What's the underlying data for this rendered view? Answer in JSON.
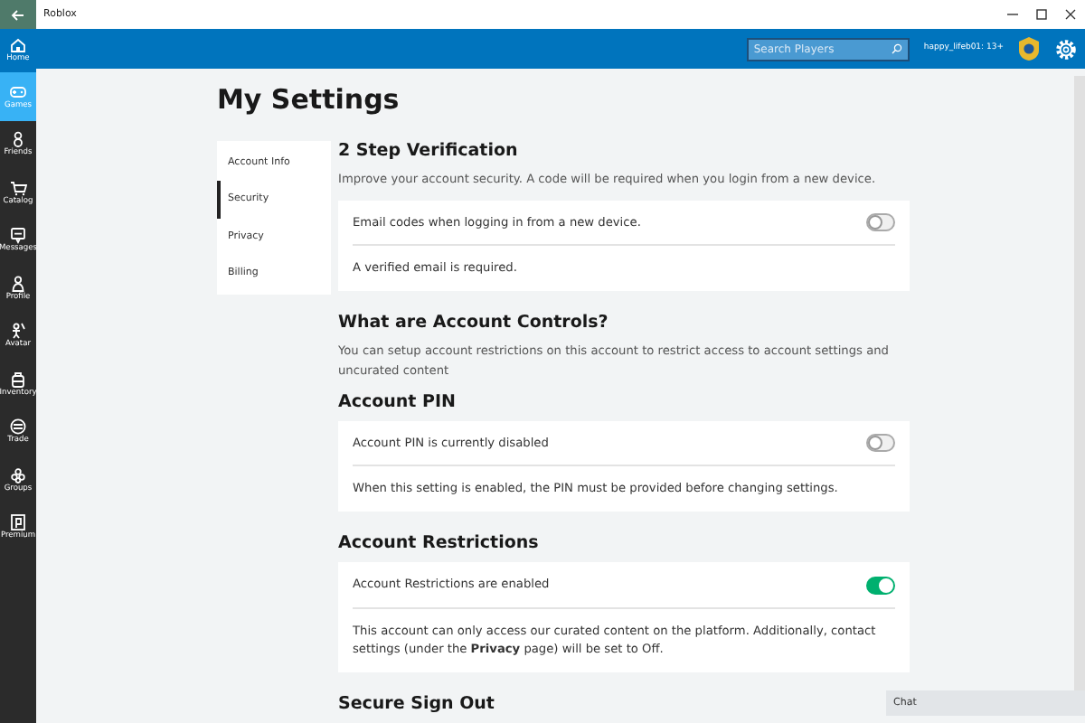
{
  "window": {
    "title": "Roblox"
  },
  "header": {
    "search": {
      "placeholder": "Search Players"
    },
    "username": "happy_lifeb01: 13+"
  },
  "rail": [
    {
      "label": "Home",
      "selected": false
    },
    {
      "label": "Games",
      "selected": true
    },
    {
      "label": "Friends",
      "selected": false
    },
    {
      "label": "Catalog",
      "selected": false
    },
    {
      "label": "Messages",
      "selected": false
    },
    {
      "label": "Profile",
      "selected": false
    },
    {
      "label": "Avatar",
      "selected": false
    },
    {
      "label": "Inventory",
      "selected": false
    },
    {
      "label": "Trade",
      "selected": false
    },
    {
      "label": "Groups",
      "selected": false
    },
    {
      "label": "Premium",
      "selected": false
    }
  ],
  "page_title": "My Settings",
  "settings_nav": [
    {
      "label": "Account Info",
      "selected": false
    },
    {
      "label": "Security",
      "selected": true
    },
    {
      "label": "Privacy",
      "selected": false
    },
    {
      "label": "Billing",
      "selected": false
    }
  ],
  "sections": [
    {
      "heading": "2 Step Verification",
      "description": "Improve your account security. A code will be required when you login from a new device.",
      "rows": [
        {
          "kind": "toggle",
          "label": "Email codes when logging in from a new device.",
          "on": false
        },
        {
          "kind": "note",
          "text": "A verified email is required."
        }
      ]
    },
    {
      "heading": "What are Account Controls?",
      "description": "You can setup account restrictions on this account to restrict access to account settings and uncurated content"
    },
    {
      "heading": "Account PIN",
      "rows": [
        {
          "kind": "toggle",
          "label": "Account PIN is currently disabled",
          "on": false
        },
        {
          "kind": "note",
          "text": "When this setting is enabled, the PIN must be provided before changing settings."
        }
      ]
    },
    {
      "heading": "Account Restrictions",
      "rows": [
        {
          "kind": "toggle",
          "label": "Account Restrictions are enabled",
          "on": true
        },
        {
          "kind": "note",
          "text": "This account can only access our curated content on the platform. Additionally, contact settings (under the **Privacy** page) will be set to Off."
        }
      ]
    },
    {
      "heading": "Secure Sign Out"
    }
  ],
  "chat": {
    "label": "Chat"
  }
}
